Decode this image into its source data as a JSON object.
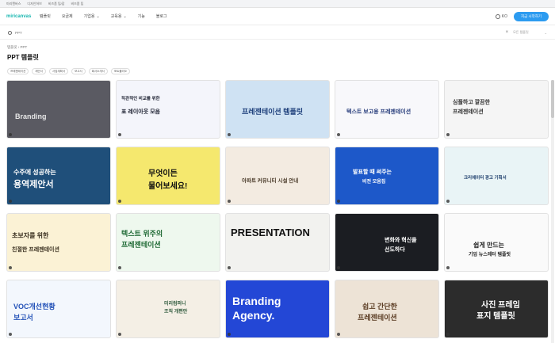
{
  "topbar": {
    "links": [
      "미리캔버스",
      "디자인허브",
      "비즈폼 팁/잡",
      "비즈폼 팁"
    ]
  },
  "nav": {
    "logo": "miricanvas",
    "items": [
      "템플릿",
      "요금제",
      "기업용",
      "교육용",
      "기능",
      "블로그"
    ],
    "lang": "KO",
    "signup": "지금 시작하기"
  },
  "search": {
    "query": "PPT",
    "filter": "모든 템플릿"
  },
  "breadcrumb": [
    "템플릿",
    "PPT"
  ],
  "page_title": "PPT 템플릿",
  "chips": [
    "프레젠테이션",
    "제안서",
    "사업계획서",
    "보고서",
    "회사소개서",
    "포트폴리오"
  ],
  "templates": [
    {
      "lines": [
        "Branding"
      ],
      "bg": "#5a5a62",
      "fg": "#e7e7e7"
    },
    {
      "lines": [
        "직관적인 비교를 위한",
        "표 레이아웃 모음"
      ],
      "bg": "#f4f5fb",
      "fg": "#1f2333"
    },
    {
      "lines": [
        "프레젠테이션 템플릿"
      ],
      "bg": "#cfe2f3",
      "fg": "#1c3e7a"
    },
    {
      "lines": [
        "텍스트 보고용 프레젠테이션"
      ],
      "bg": "#f8f8fb",
      "fg": "#2a3f7d"
    },
    {
      "lines": [
        "심플하고 깔끔한",
        "프레젠테이션"
      ],
      "bg": "#f5f5f5",
      "fg": "#333"
    },
    {
      "lines": [
        "수주에 성공하는",
        "용역제안서"
      ],
      "bg": "#1f4f7a",
      "fg": "#ffffff"
    },
    {
      "lines": [
        "무엇이든",
        "물어보세요!"
      ],
      "bg": "#f5e86e",
      "fg": "#111"
    },
    {
      "lines": [
        "아파트 커뮤니티 시설 안내"
      ],
      "bg": "#f3ebe1",
      "fg": "#4a3b2a"
    },
    {
      "lines": [
        "발표할 때 써주는",
        "비전 모음집"
      ],
      "bg": "#1d58c9",
      "fg": "#ffffff"
    },
    {
      "lines": [
        "크리에이터 광고 기획서"
      ],
      "bg": "#e9f4f6",
      "fg": "#1c3d6b"
    },
    {
      "lines": [
        "초보자를 위한",
        "친절한 프레젠테이션"
      ],
      "bg": "#fbf2d5",
      "fg": "#3a3020"
    },
    {
      "lines": [
        "텍스트 위주의",
        "프레젠테이션"
      ],
      "bg": "#eef8ee",
      "fg": "#1f6a35"
    },
    {
      "lines": [
        "PRESENTATION"
      ],
      "bg": "#f2f2ef",
      "fg": "#111"
    },
    {
      "lines": [
        "변화와 혁신을",
        "선도하다"
      ],
      "bg": "#1b1d22",
      "fg": "#ffffff"
    },
    {
      "lines": [
        "쉽게 만드는",
        "기업 뉴스레터 템플릿"
      ],
      "bg": "#fafafa",
      "fg": "#222"
    },
    {
      "lines": [
        "VOC개선현황",
        "보고서"
      ],
      "bg": "#f3f7fd",
      "fg": "#2452b8"
    },
    {
      "lines": [
        "미리컴퍼니",
        "조직 개편안"
      ],
      "bg": "#f4efe5",
      "fg": "#2f5a3d"
    },
    {
      "lines": [
        "Branding",
        "Agency."
      ],
      "bg": "#2347d6",
      "fg": "#ffffff"
    },
    {
      "lines": [
        "쉽고 간단한",
        "프레젠테이션"
      ],
      "bg": "#ede3d6",
      "fg": "#5a3b22"
    },
    {
      "lines": [
        "사진 프레임",
        "표지 템플릿"
      ],
      "bg": "#2c2c2c",
      "fg": "#ffffff"
    }
  ],
  "colors": {
    "accent": "#19b7b0",
    "signup": "#2c9bf0"
  }
}
